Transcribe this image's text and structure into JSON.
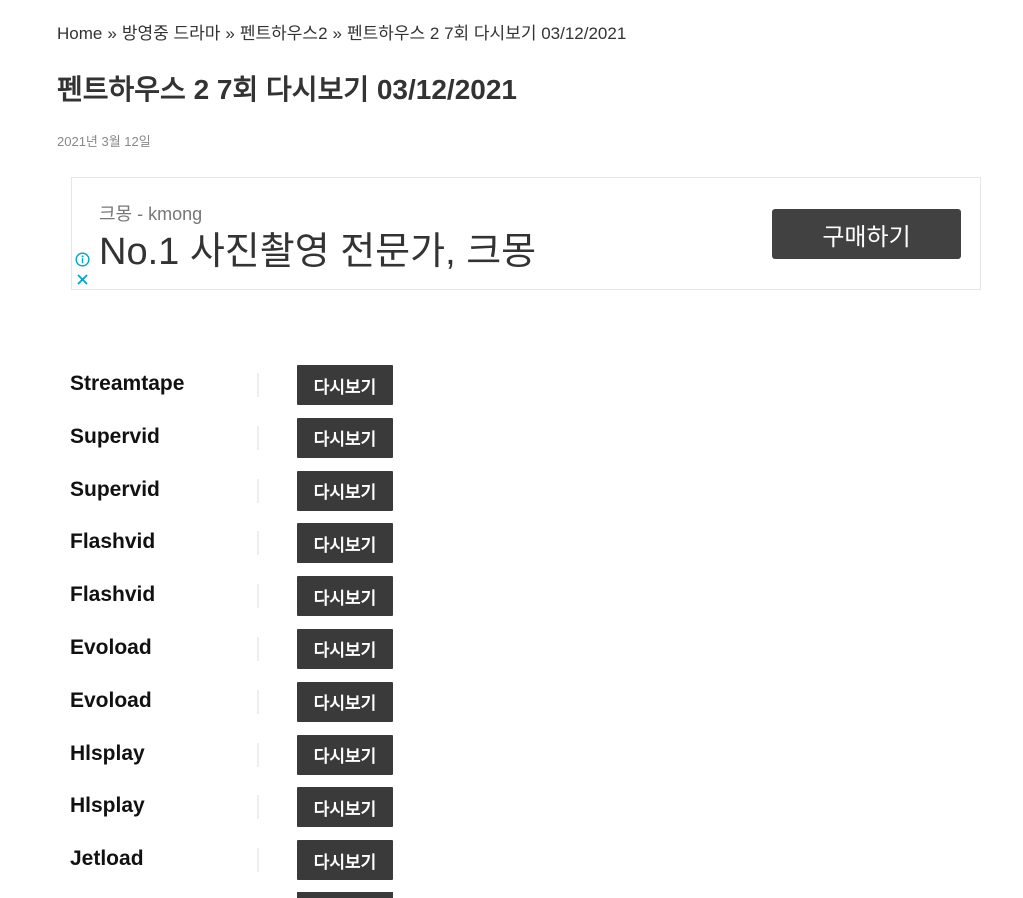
{
  "breadcrumb": {
    "items": [
      "Home",
      "방영중 드라마",
      "펜트하우스2",
      "펜트하우스 2 7회 다시보기 03/12/2021"
    ],
    "separator": "»"
  },
  "page_title": "펜트하우스 2 7회 다시보기 03/12/2021",
  "post_date": "2021년 3월 12일",
  "ad": {
    "source": "크몽 - kmong",
    "headline": "No.1 사진촬영 전문가, 크몽",
    "cta_label": "구매하기",
    "info_icon": "info-icon",
    "close_icon": "close-icon",
    "accent_color": "#00A5C7"
  },
  "servers": [
    {
      "name": "Streamtape",
      "button_label": "다시보기"
    },
    {
      "name": "Supervid",
      "button_label": "다시보기"
    },
    {
      "name": "Supervid",
      "button_label": "다시보기"
    },
    {
      "name": "Flashvid",
      "button_label": "다시보기"
    },
    {
      "name": "Flashvid",
      "button_label": "다시보기"
    },
    {
      "name": "Evoload",
      "button_label": "다시보기"
    },
    {
      "name": "Evoload",
      "button_label": "다시보기"
    },
    {
      "name": "Hlsplay",
      "button_label": "다시보기"
    },
    {
      "name": "Hlsplay",
      "button_label": "다시보기"
    },
    {
      "name": "Jetload",
      "button_label": "다시보기"
    }
  ],
  "colors": {
    "button_bg": "#3a3a3a",
    "button_text": "#ffffff",
    "ad_button_bg": "#414141"
  }
}
